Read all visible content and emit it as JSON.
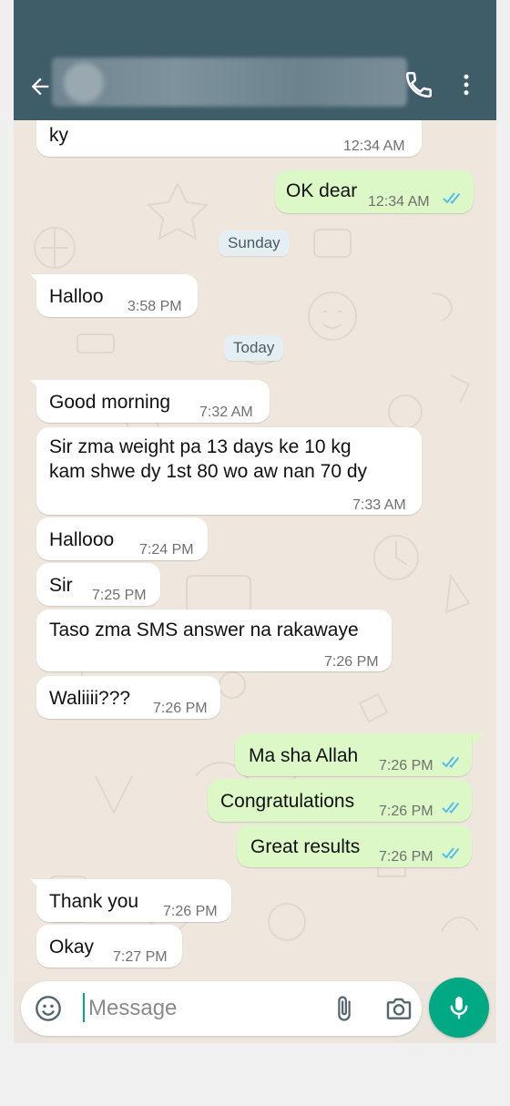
{
  "header": {
    "back_icon": "arrow-back-icon",
    "call_icon": "voice-call-icon",
    "menu_icon": "more-vert-icon"
  },
  "colors": {
    "app_bar": "#3f5c69",
    "outgoing_bubble": "#dcf8c6",
    "incoming_bubble": "#ffffff",
    "accent": "#00a884",
    "read_ticks": "#53bdeb"
  },
  "messages": [
    {
      "dir": "in",
      "text": "ky",
      "time": "12:34 AM"
    },
    {
      "dir": "out",
      "text": "OK dear",
      "time": "12:34 AM",
      "status": "read"
    },
    {
      "type": "date",
      "label": "Sunday"
    },
    {
      "dir": "in",
      "text": "Halloo",
      "time": "3:58 PM"
    },
    {
      "type": "date",
      "label": "Today"
    },
    {
      "dir": "in",
      "text": "Good morning",
      "time": "7:32 AM"
    },
    {
      "dir": "in",
      "line1": "Sir zma weight pa 13 days ke 10 kg",
      "line2": "kam shwe dy 1st 80 wo aw nan 70 dy",
      "time": "7:33 AM"
    },
    {
      "dir": "in",
      "text": "Hallooo",
      "time": "7:24 PM"
    },
    {
      "dir": "in",
      "text": "Sir",
      "time": "7:25 PM"
    },
    {
      "dir": "in",
      "text": "Taso zma SMS answer na rakawaye",
      "time": "7:26 PM"
    },
    {
      "dir": "in",
      "text": "Waliiii???",
      "time": "7:26 PM"
    },
    {
      "dir": "out",
      "text": "Ma sha Allah",
      "time": "7:26 PM",
      "status": "read"
    },
    {
      "dir": "out",
      "text": "Congratulations",
      "time": "7:26 PM",
      "status": "read"
    },
    {
      "dir": "out",
      "text": "Great results",
      "time": "7:26 PM",
      "status": "read"
    },
    {
      "dir": "in",
      "text": "Thank you",
      "time": "7:26 PM"
    },
    {
      "dir": "in",
      "text": "Okay",
      "time": "7:27 PM"
    }
  ],
  "composer": {
    "placeholder": "Message",
    "emoji_icon": "emoji-icon",
    "attach_icon": "paperclip-icon",
    "camera_icon": "camera-icon",
    "mic_icon": "mic-icon"
  }
}
